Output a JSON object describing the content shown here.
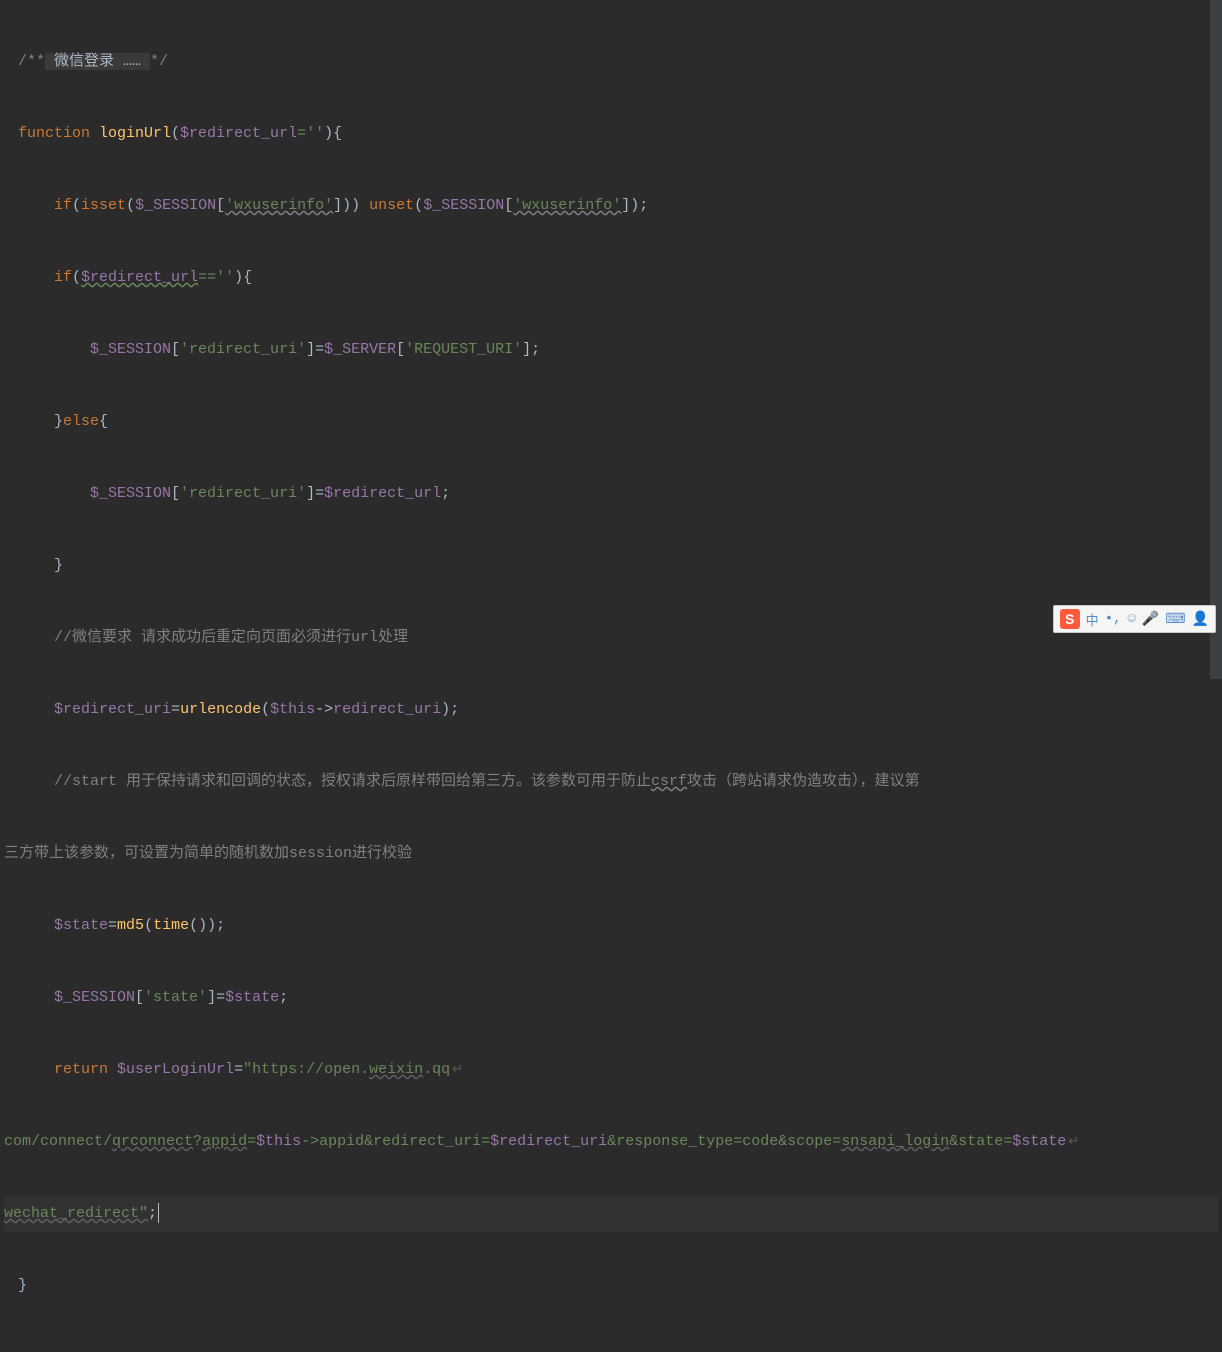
{
  "code": {
    "l1_pre": "/**",
    "l1_mid": " 微信登录 …… ",
    "l1_post": "*/",
    "l2_kw": "function ",
    "l2_fn": "loginUrl",
    "l2_open": "(",
    "l2_var": "$redirect_url",
    "l2_eq": "=''",
    "l2_close": "){",
    "l3_if": "if",
    "l3_p1": "(",
    "l3_isset": "isset",
    "l3_p2": "(",
    "l3_sess": "$_SESSION",
    "l3_b1": "[",
    "l3_str1": "'wxuserinfo'",
    "l3_b2": "])) ",
    "l3_unset": "unset",
    "l3_p3": "(",
    "l3_sess2": "$_SESSION",
    "l3_b3": "[",
    "l3_str2": "'wxuserinfo'",
    "l3_b4": "]);",
    "l4_if": "if",
    "l4_p1": "(",
    "l4_var": "$redirect_url",
    "l4_eq": "==''",
    "l4_close": "){",
    "l5_sess": "$_SESSION",
    "l5_b1": "[",
    "l5_str": "'redirect_uri'",
    "l5_eq": "]=",
    "l5_srv": "$_SERVER",
    "l5_b2": "[",
    "l5_str2": "'REQUEST_URI'",
    "l5_end": "];",
    "l6_close": "}",
    "l6_else": "else",
    "l6_open": "{",
    "l7_sess": "$_SESSION",
    "l7_b1": "[",
    "l7_str": "'redirect_uri'",
    "l7_mid": "]=",
    "l7_var": "$redirect_url",
    "l7_end": ";",
    "l8_close": "}",
    "l9_c": "//微信要求 请求成功后重定向页面必须进行url处理",
    "l10_var": "$redirect_uri",
    "l10_eq": "=",
    "l10_fn": "urlencode",
    "l10_p1": "(",
    "l10_this": "$this",
    "l10_arrow": "->",
    "l10_prop": "redirect_uri",
    "l10_end": ");",
    "l11_a": "//start 用于保持请求和回调的状态，授权请求后原样带回给第三方。该参数可用于防止",
    "l11_csrf": "csrf",
    "l11_b": "攻击（跨站请求伪造攻击），建议第",
    "l12": "三方带上该参数，可设置为简单的随机数加session进行校验",
    "l13_var": "$state",
    "l13_eq": "=",
    "l13_fn": "md5",
    "l13_p1": "(",
    "l13_fn2": "time",
    "l13_p2": "());",
    "l14_sess": "$_SESSION",
    "l14_b1": "[",
    "l14_str": "'state'",
    "l14_mid": "]=",
    "l14_var": "$state",
    "l14_end": ";",
    "l15_ret": "return ",
    "l15_var": "$userLoginUrl",
    "l15_eq": "=",
    "l15_str1": "\"https://open.",
    "l15_wx": "weixin",
    "l15_str2": ".qq",
    "l16_a": "com/connect/",
    "l16_qr": "qrconnect",
    "l16_b": "?",
    "l16_appid": "appid",
    "l16_c": "=",
    "l16_this": "$this",
    "l16_arrow": "->",
    "l16_d": "appid&redirect_uri=",
    "l16_ru": "$redirect_uri",
    "l16_e": "&response_type=code&scope=",
    "l16_sns": "snsapi_login",
    "l16_f": "&state=",
    "l16_st": "$state",
    "l17_a": "wechat_redirect\"",
    "l17_end": ";",
    "l18": "}"
  },
  "ime": {
    "logo": "S",
    "mode": "中",
    "dot": "•"
  }
}
